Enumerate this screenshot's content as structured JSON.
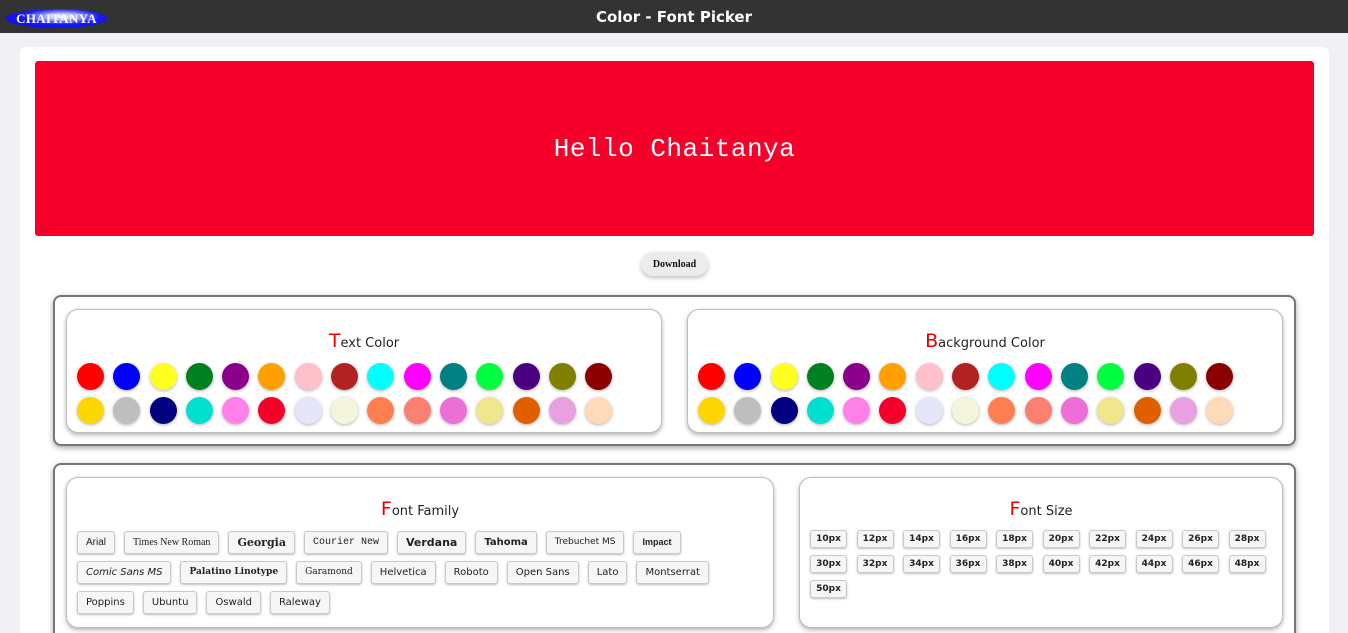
{
  "header": {
    "logo_text": "CHAITANYA",
    "title": "Color - Font Picker"
  },
  "preview": {
    "text": "Hello Chaitanya",
    "background_color": "#f5002b",
    "text_color": "#ffffff",
    "font": "Courier New"
  },
  "download_label": "Download",
  "text_color_panel": {
    "initial": "T",
    "rest": "ext Color"
  },
  "background_color_panel": {
    "initial": "B",
    "rest": "ackground Color"
  },
  "font_family_panel": {
    "initial": "F",
    "rest": "ont Family"
  },
  "font_size_panel": {
    "initial": "F",
    "rest": "ont Size"
  },
  "colors": [
    "#ff0000",
    "#0000ff",
    "#ffff22",
    "#008020",
    "#8b008b",
    "#ffa000",
    "#ffc0cb",
    "#b22222",
    "#00ffff",
    "#ff00ff",
    "#008080",
    "#00ff40",
    "#4b0082",
    "#808000",
    "#8b0000",
    "#ffd700",
    "#bebebe",
    "#000080",
    "#00e0d0",
    "#ff80e8",
    "#f5002b",
    "#e6e6fa",
    "#f5f5dc",
    "#ff7f50",
    "#fa8072",
    "#ee6ed8",
    "#f0e68c",
    "#e06000",
    "#e8a0e0",
    "#ffdab9"
  ],
  "fonts": [
    "Arial",
    "Times New Roman",
    "Georgia",
    "Courier New",
    "Verdana",
    "Tahoma",
    "Trebuchet MS",
    "Impact",
    "Comic Sans MS",
    "Palatino Linotype",
    "Garamond",
    "Helvetica",
    "Roboto",
    "Open Sans",
    "Lato",
    "Montserrat",
    "Poppins",
    "Ubuntu",
    "Oswald",
    "Raleway"
  ],
  "sizes": [
    "10px",
    "12px",
    "14px",
    "16px",
    "18px",
    "20px",
    "22px",
    "24px",
    "26px",
    "28px",
    "30px",
    "32px",
    "34px",
    "36px",
    "38px",
    "40px",
    "42px",
    "44px",
    "46px",
    "48px",
    "50px"
  ]
}
